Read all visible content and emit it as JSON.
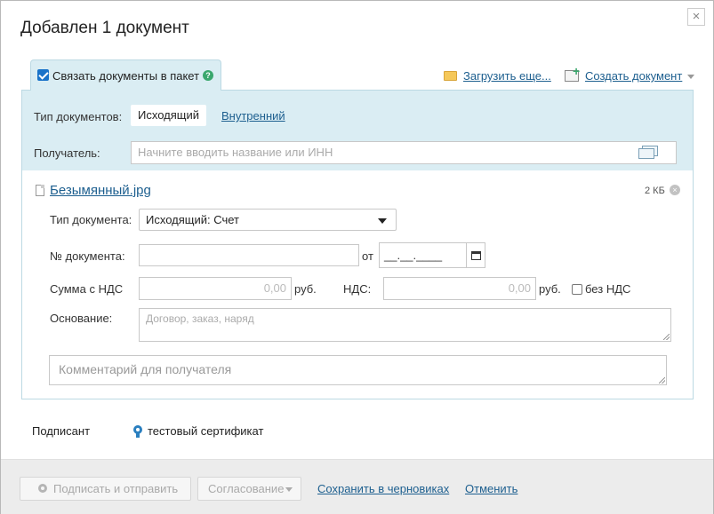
{
  "dialog": {
    "title": "Добавлен 1 документ",
    "close_symbol": "×"
  },
  "tab": {
    "label": "Связать документы в пакет",
    "checked": true,
    "help_symbol": "?"
  },
  "actions": {
    "upload_more": "Загрузить еще...",
    "create_document": "Создать документ"
  },
  "doc_types": {
    "label": "Тип документов:",
    "selected": "Исходящий",
    "other": "Внутренний"
  },
  "recipient": {
    "label": "Получатель:",
    "placeholder": "Начните вводить название или ИНН"
  },
  "file": {
    "name": "Безымянный.jpg",
    "size": "2 КБ",
    "remove_symbol": "×"
  },
  "form": {
    "doc_type_label": "Тип документа:",
    "doc_type_value": "Исходящий: Счет",
    "doc_number_label": "№ документа:",
    "doc_number_value": "",
    "date_from_label": "от",
    "date_mask": "__.__.____",
    "sum_label": "Сумма с НДС",
    "sum_value": "0,00",
    "currency": "руб.",
    "vat_label": "НДС:",
    "vat_value": "0,00",
    "no_vat_label": "без НДС",
    "basis_label": "Основание:",
    "basis_placeholder": "Договор, заказ, наряд",
    "comment_placeholder": "Комментарий для получателя"
  },
  "signer": {
    "label": "Подписант",
    "certificate": "тестовый сертификат"
  },
  "footer": {
    "sign_send": "Подписать и отправить",
    "approval": "Согласование",
    "save_draft": "Сохранить в черновиках",
    "cancel": "Отменить"
  },
  "colors": {
    "accent_panel": "#daedf3",
    "link": "#1d5f8f",
    "success": "#3aa76d"
  }
}
